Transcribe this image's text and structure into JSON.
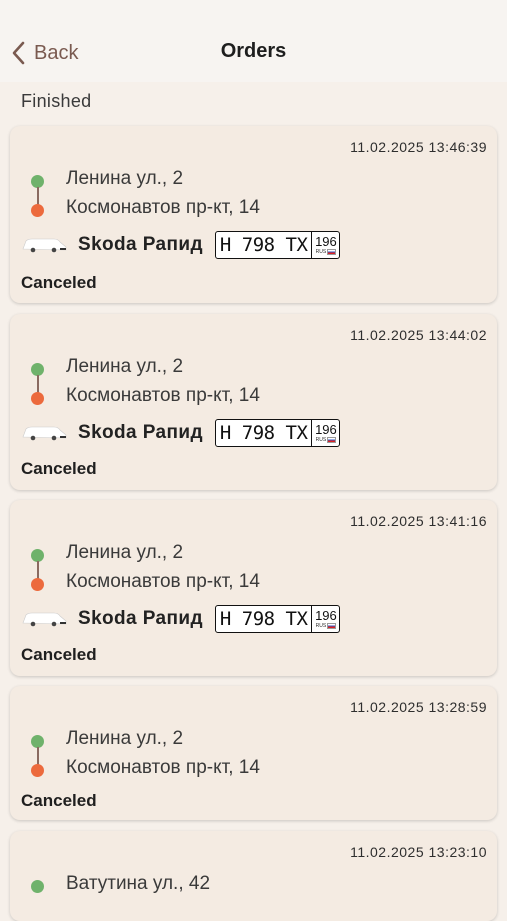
{
  "header": {
    "back_label": "Back",
    "title": "Orders"
  },
  "section_label": "Finished",
  "orders": [
    {
      "timestamp": "11.02.2025 13:46:39",
      "from": "Ленина ул., 2",
      "to": "Космонавтов пр-кт, 14",
      "car": "Skoda Рапид",
      "plate_main": "Н 798 ТХ",
      "plate_region": "196",
      "plate_country": "RUS",
      "status": "Canceled"
    },
    {
      "timestamp": "11.02.2025 13:44:02",
      "from": "Ленина ул., 2",
      "to": "Космонавтов пр-кт, 14",
      "car": "Skoda Рапид",
      "plate_main": "Н 798 ТХ",
      "plate_region": "196",
      "plate_country": "RUS",
      "status": "Canceled"
    },
    {
      "timestamp": "11.02.2025 13:41:16",
      "from": "Ленина ул., 2",
      "to": "Космонавтов пр-кт, 14",
      "car": "Skoda Рапид",
      "plate_main": "Н 798 ТХ",
      "plate_region": "196",
      "plate_country": "RUS",
      "status": "Canceled"
    },
    {
      "timestamp": "11.02.2025 13:28:59",
      "from": "Ленина ул., 2",
      "to": "Космонавтов пр-кт, 14",
      "status": "Canceled"
    },
    {
      "timestamp": "11.02.2025 13:23:10",
      "from": "Ватутина ул., 42"
    }
  ],
  "colors": {
    "accent": "#7a5a50",
    "card_bg": "#f4ebe2",
    "page_bg": "#f6f0ea",
    "pickup_dot": "#6fb26b",
    "dropoff_dot": "#ec6a3d"
  },
  "icons": {
    "back": "chevron-left-icon",
    "car": "car-icon",
    "pickup": "pickup-dot-icon",
    "dropoff": "dropoff-dot-icon"
  }
}
